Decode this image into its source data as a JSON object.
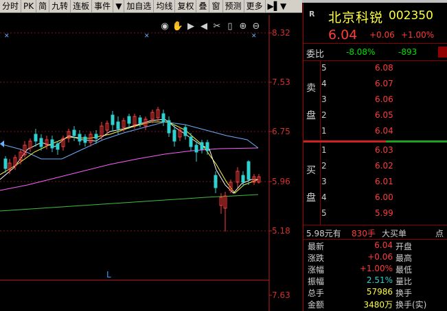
{
  "toolbar": {
    "items": [
      {
        "label": "分时"
      },
      {
        "label": "PK"
      },
      {
        "label": "简"
      },
      {
        "label": "九转"
      },
      {
        "label": "连板"
      },
      {
        "label": "事件"
      },
      {
        "label": "▼"
      },
      {
        "label": "加自选"
      },
      {
        "label": "均线"
      },
      {
        "label": "复权"
      },
      {
        "label": "叠"
      },
      {
        "label": "窗"
      },
      {
        "label": "预测"
      },
      {
        "label": "更多"
      },
      {
        "label": "▶▌▼"
      }
    ]
  },
  "chart": {
    "price_labels": [
      "8.32",
      "7.53",
      "6.75",
      "5.96",
      "5.18",
      "7.63"
    ],
    "axis_marker": "L",
    "icons": [
      "eye-icon",
      "hand-icon",
      "play-icon",
      "rewind-icon",
      "scissors-icon",
      "pin-icon",
      "zoom-in-icon",
      "zoom-out-icon"
    ],
    "icon_glyphs": [
      "◉",
      "✋",
      "▶",
      "◀",
      "✂",
      "▯",
      "⊕",
      "⊖"
    ],
    "colors": {
      "up": "#ff3c3c",
      "down": "#30d0d0",
      "ma5": "#ffffff",
      "ma10": "#ffff40",
      "ma20": "#6ab0ff",
      "ma60": "#ff60ff",
      "ma120": "#40c040"
    }
  },
  "quote": {
    "badge": "R",
    "name": "北京科锐",
    "code": "002350",
    "price": "6.04",
    "change": "+0.06",
    "change_pct": "+1.00%",
    "commission_label": "委比",
    "commission_ratio": "-8.08%",
    "commission_diff": "-893",
    "sell_label_1": "卖",
    "sell_label_2": "盘",
    "buy_label_1": "买",
    "buy_label_2": "盘",
    "sell_orders": [
      {
        "level": "5",
        "price": "6.08"
      },
      {
        "level": "4",
        "price": "6.07"
      },
      {
        "level": "3",
        "price": "6.06"
      },
      {
        "level": "2",
        "price": "6.05"
      },
      {
        "level": "1",
        "price": "6.04"
      }
    ],
    "buy_orders": [
      {
        "level": "1",
        "price": "6.03"
      },
      {
        "level": "2",
        "price": "6.02"
      },
      {
        "level": "3",
        "price": "6.01"
      },
      {
        "level": "4",
        "price": "6.00"
      },
      {
        "level": "5",
        "price": "5.99"
      }
    ],
    "big_order": {
      "price": "5.98元有",
      "qty": "830手",
      "label": "大买单",
      "extra": "点"
    },
    "stats": [
      {
        "label": "最新",
        "value": "6.04",
        "label2": "开盘"
      },
      {
        "label": "涨跌",
        "value": "+0.06",
        "label2": "最高"
      },
      {
        "label": "涨幅",
        "value": "+1.00%",
        "label2": "最低"
      },
      {
        "label": "振幅",
        "value": "2.51%",
        "label2": "量比"
      },
      {
        "label": "总手",
        "value": "57986",
        "label2": "换手"
      },
      {
        "label": "金额",
        "value": "3480万",
        "label2": "换手(实)"
      }
    ]
  }
}
